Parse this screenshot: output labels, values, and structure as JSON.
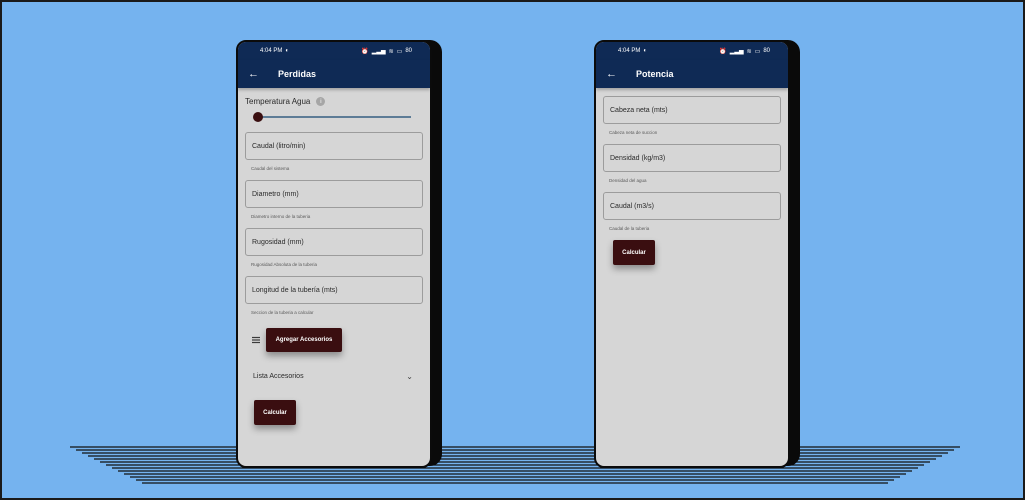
{
  "left_phone": {
    "status": {
      "time": "4:04 PM",
      "battery": "80"
    },
    "title": "Perdidas",
    "temp_label": "Temperatura Agua",
    "info_icon": "info-icon",
    "slider_value": 0,
    "fields": [
      {
        "label": "Caudal (litro/min)",
        "helper": "Caudal del sistema"
      },
      {
        "label": "Diametro (mm)",
        "helper": "Diametro interno de la tuberia"
      },
      {
        "label": "Rugosidad (mm)",
        "helper": "Rugosidad Absoluta de la tuberia"
      },
      {
        "label": "Longitud de la tubería (mts)",
        "helper": "Seccion de la tuberia a calcular"
      }
    ],
    "add_button": "Agregar Accesorios",
    "list_label": "Lista Accesorios",
    "calc_button": "Calcular"
  },
  "right_phone": {
    "status": {
      "time": "4:04 PM",
      "battery": "80"
    },
    "title": "Potencia",
    "fields": [
      {
        "label": "Cabeza neta (mts)",
        "helper": "Cabeza neta de succion"
      },
      {
        "label": "Densidad (kg/m3)",
        "helper": "Densidad del agua"
      },
      {
        "label": "Caudal (m3/s)",
        "helper": "Caudal de la tuberia"
      }
    ],
    "calc_button": "Calcular"
  },
  "colors": {
    "background": "#75b3ef",
    "app_bar": "#0f2a55",
    "button": "#3a0e10",
    "screen": "#d6d6d6"
  }
}
